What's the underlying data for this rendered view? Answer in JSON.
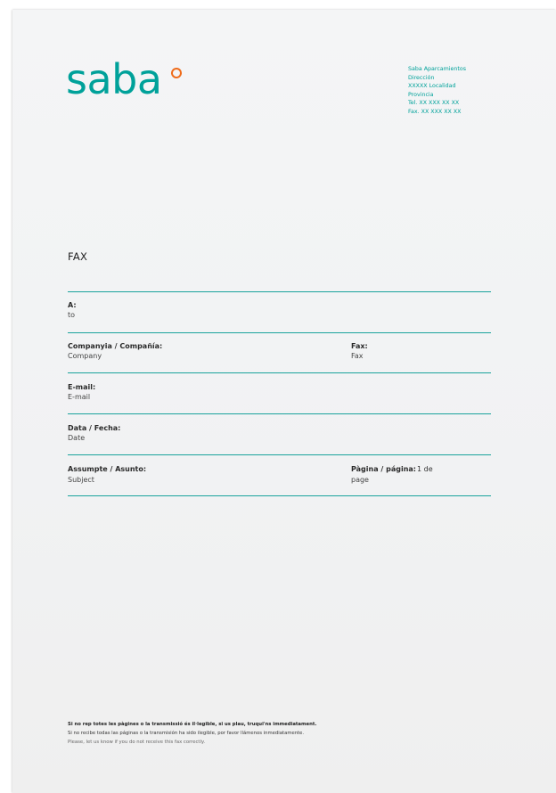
{
  "brand": {
    "logo_text": "saba",
    "teal": "#00a19a",
    "accent_orange": "#ef6b1a"
  },
  "address": {
    "lines": [
      "Saba Aparcamientos",
      "Dirección",
      "XXXXX Localidad",
      "Provincia",
      "Tel. XX XXX XX XX",
      "Fax. XX XXX XX XX"
    ]
  },
  "title": "FAX",
  "fields": {
    "to": {
      "label": "A:",
      "sub": "to"
    },
    "company": {
      "label": "Companyia / Compañía:",
      "sub": "Company"
    },
    "fax": {
      "label": "Fax:",
      "sub": "Fax"
    },
    "email": {
      "label": "E-mail:",
      "sub": "E-mail"
    },
    "date": {
      "label": "Data / Fecha:",
      "sub": "Date"
    },
    "subject": {
      "label": "Assumpte / Asunto:",
      "sub": "Subject"
    },
    "page": {
      "label": "Pàgina / página:",
      "sub": "page",
      "value": "1 de"
    }
  },
  "footer": {
    "line1": "Si no rep totes les pàgines o la transmissió és il·legible, si us plau, truqui'ns immediatament.",
    "line2": "Si no recibe todas las páginas o la transmisión ha sido ilegible, por favor llámenos inmediatamente.",
    "line3": "Please, let us know if you do not receive this fax correctly."
  }
}
